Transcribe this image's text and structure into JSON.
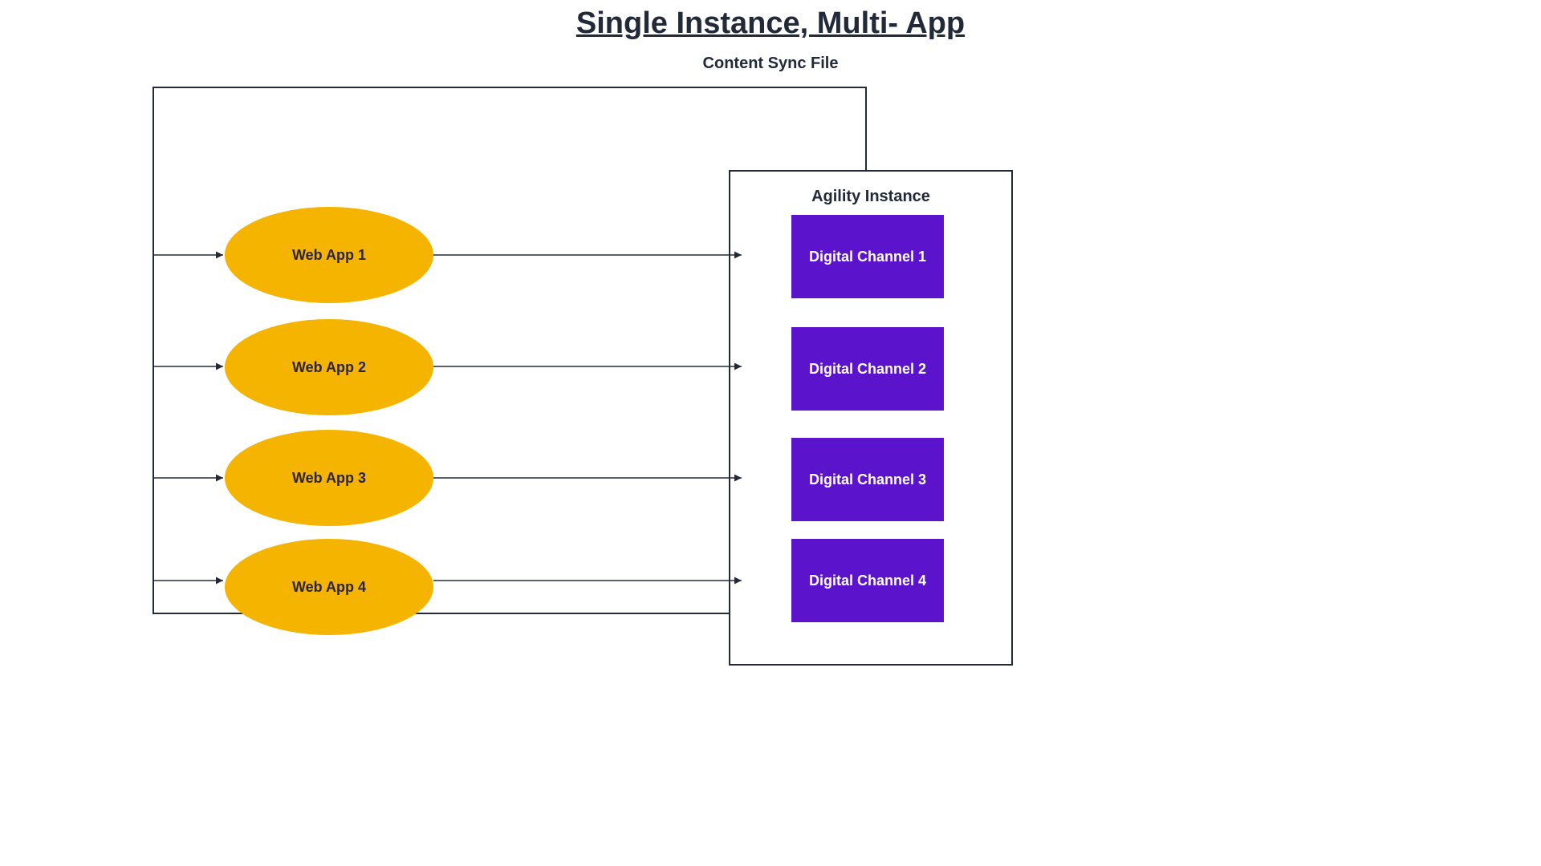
{
  "title": "Single Instance, Multi- App",
  "subtitle": "Content Sync File",
  "instance_label": "Agility Instance",
  "colors": {
    "accent_orange": "#f4b400",
    "accent_purple": "#5b14cc",
    "line": "#222a3a",
    "text_dark": "#222a3a"
  },
  "webapps": [
    {
      "label": "Web App 1"
    },
    {
      "label": "Web App 2"
    },
    {
      "label": "Web App 3"
    },
    {
      "label": "Web App 4"
    }
  ],
  "channels": [
    {
      "label": "Digital Channel 1"
    },
    {
      "label": "Digital Channel 2"
    },
    {
      "label": "Digital Channel 3"
    },
    {
      "label": "Digital Channel 4"
    }
  ],
  "diagram_structure": {
    "description": "A 'Content Sync File' container routes to four Web App nodes (ellipses). Each Web App points to a corresponding Digital Channel inside a single 'Agility Instance' box.",
    "edges": [
      {
        "from": "Content Sync File",
        "to": "Web App 1"
      },
      {
        "from": "Content Sync File",
        "to": "Web App 2"
      },
      {
        "from": "Content Sync File",
        "to": "Web App 3"
      },
      {
        "from": "Content Sync File",
        "to": "Web App 4"
      },
      {
        "from": "Web App 1",
        "to": "Digital Channel 1"
      },
      {
        "from": "Web App 2",
        "to": "Digital Channel 2"
      },
      {
        "from": "Web App 3",
        "to": "Digital Channel 3"
      },
      {
        "from": "Web App 4",
        "to": "Digital Channel 4"
      }
    ]
  }
}
